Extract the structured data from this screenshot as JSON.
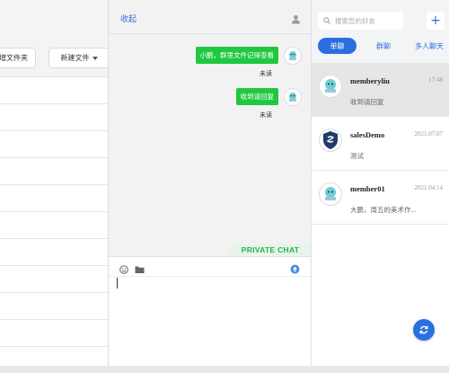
{
  "file_panel": {
    "new_folder_label": "增文件夹",
    "new_file_label": "新建文件",
    "row_count": 11
  },
  "chat": {
    "collapse_label": "收起",
    "messages": [
      {
        "text": "小鹏，群里文件记得查看",
        "status": "未读"
      },
      {
        "text": "收到请回复",
        "status": "未读"
      }
    ],
    "private_chat_label": "PRIVATE CHAT",
    "icons": {
      "user": "user-icon",
      "emoji": "emoji-icon",
      "folder": "folder-icon",
      "send": "send-icon"
    }
  },
  "contacts_panel": {
    "search_placeholder": "搜索您的好友",
    "add_label": "+",
    "tabs": [
      {
        "label": "单聊",
        "active": true
      },
      {
        "label": "群聊",
        "active": false
      },
      {
        "label": "多人聊天",
        "active": false
      }
    ],
    "contacts": [
      {
        "name": "memberyliu",
        "time": "17:48",
        "last_message": "收到请回复",
        "selected": true
      },
      {
        "name": "salesDemo",
        "time": "2021.07.07",
        "last_message": "测试",
        "selected": false
      },
      {
        "name": "member01",
        "time": "2021.04.14",
        "last_message": "大鹏，周五的美术作...",
        "selected": false
      }
    ]
  },
  "colors": {
    "accent_blue": "#2a6fe0",
    "bubble_green": "#20c840",
    "private_chat_green": "#2bb24c"
  }
}
